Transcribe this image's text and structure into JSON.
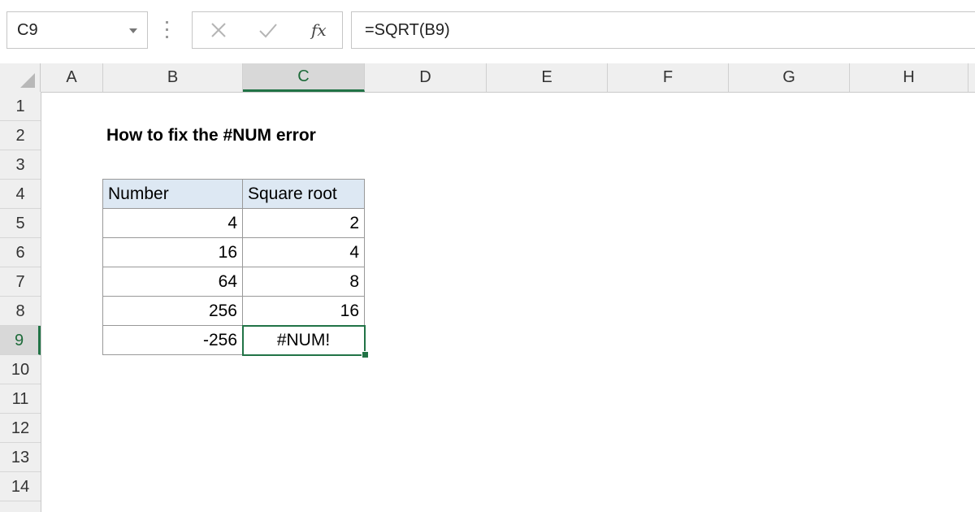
{
  "formula_bar": {
    "name_box": "C9",
    "fx_label": "fx",
    "formula": "=SQRT(B9)"
  },
  "columns": [
    "A",
    "B",
    "C",
    "D",
    "E",
    "F",
    "G",
    "H"
  ],
  "rows": [
    "1",
    "2",
    "3",
    "4",
    "5",
    "6",
    "7",
    "8",
    "9",
    "10",
    "11",
    "12",
    "13",
    "14"
  ],
  "selected_cell": {
    "column": "C",
    "row": "9"
  },
  "title": "How to fix the #NUM error",
  "table": {
    "headers": [
      "Number",
      "Square root"
    ],
    "rows": [
      [
        "4",
        "2"
      ],
      [
        "16",
        "4"
      ],
      [
        "64",
        "8"
      ],
      [
        "256",
        "16"
      ],
      [
        "-256",
        "#NUM!"
      ]
    ]
  },
  "colors": {
    "accent": "#217346",
    "table_header_fill": "#dde8f3"
  }
}
